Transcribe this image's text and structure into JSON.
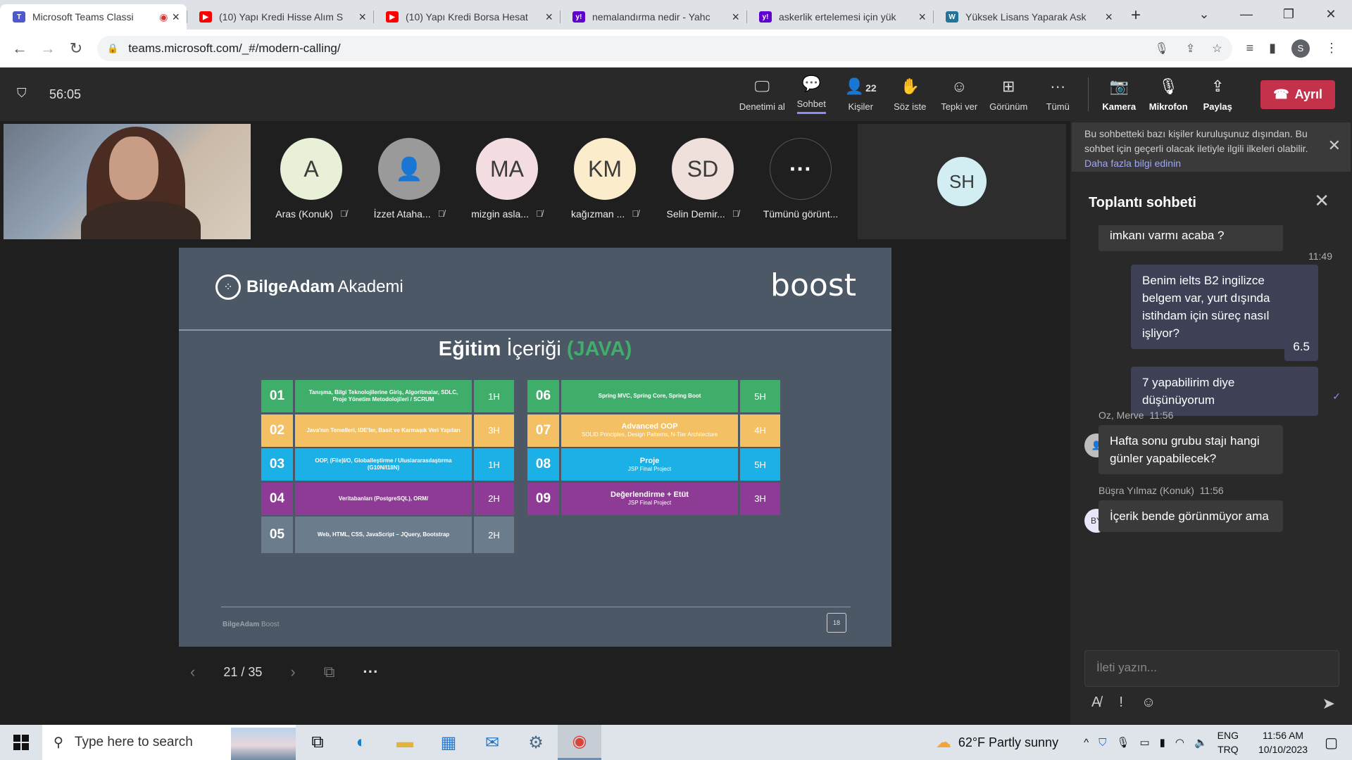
{
  "browser": {
    "tabs": [
      {
        "title": "Microsoft Teams Classi",
        "favicon": "teams-icon",
        "fav_color": "#5059c9",
        "active": true
      },
      {
        "title": "(10) Yapı Kredi Hisse Alım S",
        "favicon": "youtube-icon",
        "fav_color": "#ff0000",
        "active": false
      },
      {
        "title": "(10) Yapı Kredi Borsa Hesat",
        "favicon": "youtube-icon",
        "fav_color": "#ff0000",
        "active": false
      },
      {
        "title": "nemalandırma nedir - Yahc",
        "favicon": "yahoo-icon",
        "fav_color": "#6001d2",
        "active": false
      },
      {
        "title": "askerlik ertelemesi için yük",
        "favicon": "yahoo-icon",
        "fav_color": "#6001d2",
        "active": false
      },
      {
        "title": "Yüksek Lisans Yaparak Ask",
        "favicon": "wordpress-icon",
        "fav_color": "#21759b",
        "active": false
      }
    ],
    "url": "teams.microsoft.com/_#/modern-calling/",
    "profile_initial": "S"
  },
  "meeting": {
    "timer": "56:05",
    "tools": [
      {
        "label": "Denetimi al",
        "icon": "take-control-icon",
        "glyph": "🖵"
      },
      {
        "label": "Sohbet",
        "icon": "chat-icon",
        "glyph": "💬",
        "selected": true
      },
      {
        "label": "Kişiler",
        "icon": "people-icon",
        "glyph": "👤",
        "count": "22"
      },
      {
        "label": "Söz iste",
        "icon": "raise-hand-icon",
        "glyph": "✋"
      },
      {
        "label": "Tepki ver",
        "icon": "react-icon",
        "glyph": "☺"
      },
      {
        "label": "Görünüm",
        "icon": "view-icon",
        "glyph": "⊞"
      },
      {
        "label": "Tümü",
        "icon": "more-icon",
        "glyph": "···"
      }
    ],
    "media": [
      {
        "label": "Kamera",
        "icon": "camera-off-icon",
        "glyph": "📷"
      },
      {
        "label": "Mikrofon",
        "icon": "mic-off-icon",
        "glyph": "🎙"
      },
      {
        "label": "Paylaş",
        "icon": "share-icon",
        "glyph": "⇪"
      }
    ],
    "leave_label": "Ayrıl"
  },
  "participants": [
    {
      "initials": "A",
      "name": "Aras (Konuk)",
      "color": "#e8f0d8"
    },
    {
      "initials": "👤",
      "name": "İzzet Ataha...",
      "color": "#9a9a9a"
    },
    {
      "initials": "MA",
      "name": "mizgin asla...",
      "color": "#f4dde0"
    },
    {
      "initials": "KM",
      "name": "kağızman ...",
      "color": "#fbeccc"
    },
    {
      "initials": "SD",
      "name": "Selin Demir...",
      "color": "#efe0dc"
    },
    {
      "initials": "···",
      "name": "Tümünü görünt...",
      "color": "#1f1f1f"
    }
  ],
  "speaker_tile": {
    "initials": "SH"
  },
  "slide": {
    "brand_bold": "BilgeAdam",
    "brand_light": "Akademi",
    "boost": "boost",
    "title_bold": "Eğitim",
    "title_light": "İçeriği",
    "title_accent": "(JAVA)",
    "rows": [
      {
        "num": "01",
        "desc": "Tanışma, Bilgi Teknolojilerine Giriş, Algoritmalar, SDLC, Proje Yönetim Metodolojileri / SCRUM",
        "sub": "",
        "hours": "1H",
        "color": "#3fae6a",
        "col": 0,
        "row": 0
      },
      {
        "num": "02",
        "desc": "Java'nın Temelleri, IDE'ler, Basit ve Karmaşık Veri Yapıları",
        "sub": "",
        "hours": "3H",
        "color": "#f3c063",
        "col": 0,
        "row": 1
      },
      {
        "num": "03",
        "desc": "OOP, (File)I/O, Globalleştirme / Uluslararasılaştırma (G10N/I18N)",
        "sub": "",
        "hours": "1H",
        "color": "#1bb0e6",
        "col": 0,
        "row": 2
      },
      {
        "num": "04",
        "desc": "Veritabanları (PostgreSQL), ORM/",
        "sub": "",
        "hours": "2H",
        "color": "#8e3b95",
        "col": 0,
        "row": 3
      },
      {
        "num": "05",
        "desc": "Web, HTML, CSS, JavaScript – JQuery, Bootstrap",
        "sub": "",
        "hours": "2H",
        "color": "#6b7c8c",
        "col": 0,
        "row": 4
      },
      {
        "num": "06",
        "desc": "Spring MVC, Spring Core, Spring Boot",
        "sub": "",
        "hours": "5H",
        "color": "#3fae6a",
        "col": 1,
        "row": 0
      },
      {
        "num": "07",
        "desc": "Advanced OOP",
        "sub": "SOLID Principles, Design Patterns, N-Tier Architecture",
        "hours": "4H",
        "color": "#f3c063",
        "col": 1,
        "row": 1
      },
      {
        "num": "08",
        "desc": "Proje",
        "sub": "JSP Final Project",
        "hours": "5H",
        "color": "#1bb0e6",
        "col": 1,
        "row": 2
      },
      {
        "num": "09",
        "desc": "Değerlendirme + Etüt",
        "sub": "JSP Final Project",
        "hours": "3H",
        "color": "#8e3b95",
        "col": 1,
        "row": 3
      }
    ],
    "footer_brand": "BilgeAdam",
    "footer_light": "Boost",
    "page_no": "18",
    "counter": "21 / 35"
  },
  "chat": {
    "notice": "Bu sohbetteki bazı kişiler kuruluşunuz dışından. Bu sohbet için geçerli olacak iletiyle ilgili ilkeleri olabilir.",
    "notice_link": "Daha fazla bilgi edinin",
    "title": "Toplantı sohbeti",
    "partial_msg": "imkanı varmı acaba ?",
    "my_time": "11:49",
    "my_msgs": [
      "Benim ielts B2 ingilizce belgem var, yurt dışında istihdam için süreç nasıl işliyor?",
      "6.5",
      "7 yapabilirim diye düşünüyorum"
    ],
    "msg1_author": "Oz, Merve",
    "msg1_time": "11:56",
    "msg1_text": "Hafta sonu grubu stajı  hangi günler yapabilecek?",
    "msg2_author": "Büşra Yılmaz (Konuk)",
    "msg2_time": "11:56",
    "msg2_initials": "BY",
    "msg2_text": "İçerik bende görünmüyor ama",
    "compose_placeholder": "İleti yazın..."
  },
  "taskbar": {
    "search_placeholder": "Type here to search",
    "weather": "62°F  Partly sunny",
    "lang1": "ENG",
    "lang2": "TRQ",
    "time": "11:56 AM",
    "date": "10/10/2023"
  }
}
